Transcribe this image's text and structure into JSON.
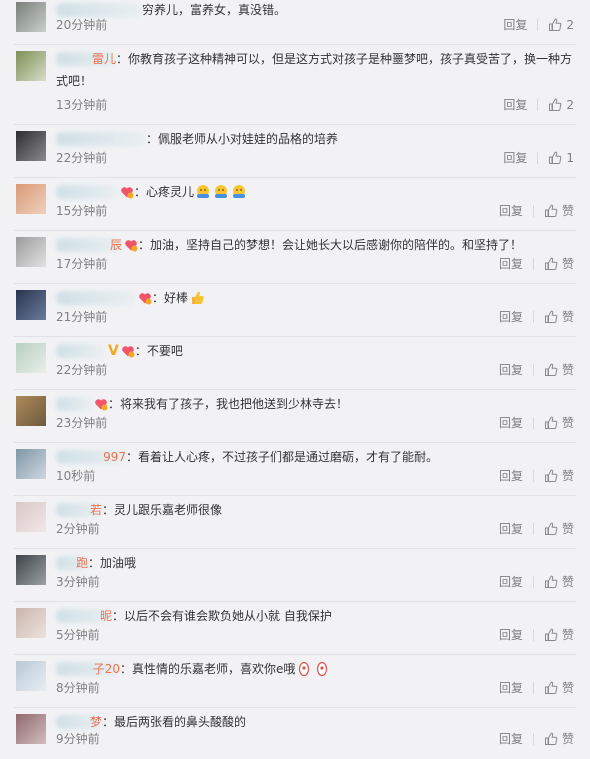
{
  "colors": {
    "username": "#eb7350",
    "text": "#333333",
    "meta": "#808080",
    "bg": "#f2f2f5"
  },
  "comments": [
    {
      "name_tail": "",
      "text": "穷养儿，富养女，真没错。",
      "time": "20分钟前",
      "reply": "回复",
      "like": "2",
      "badge": "none",
      "emoji": []
    },
    {
      "name_tail": "雷儿",
      "text": "：你教育孩子这种精神可以，但是这方式对孩子是种噩梦吧，孩子真受苦了，换一种方式吧！",
      "time": "13分钟前",
      "reply": "回复",
      "like": "2",
      "badge": "none",
      "emoji": []
    },
    {
      "name_tail": "",
      "text": "：佩服老师从小对娃娃的品格的培养",
      "time": "22分钟前",
      "reply": "回复",
      "like": "1",
      "badge": "none",
      "emoji": []
    },
    {
      "name_tail": "",
      "text": "：心疼灵儿",
      "time": "15分钟前",
      "reply": "回复",
      "like": "赞",
      "badge": "vip-heart",
      "emoji": [
        "hug-emoji",
        "hug-emoji",
        "hug-emoji"
      ]
    },
    {
      "name_tail": "辰",
      "text": "：加油，坚持自己的梦想！会让她长大以后感谢你的陪伴的。和坚持了！",
      "time": "17分钟前",
      "reply": "回复",
      "like": "赞",
      "badge": "vip-heart",
      "emoji": []
    },
    {
      "name_tail": "",
      "text": "：好棒",
      "time": "21分钟前",
      "reply": "回复",
      "like": "赞",
      "badge": "vip-heart",
      "emoji": [
        "thumbs-up-emoji"
      ]
    },
    {
      "name_tail": "",
      "text": "：不要吧",
      "time": "22分钟前",
      "reply": "回复",
      "like": "赞",
      "badge": "v-vip-heart",
      "emoji": []
    },
    {
      "name_tail": "",
      "text": "：将来我有了孩子，我也把他送到少林寺去！",
      "time": "23分钟前",
      "reply": "回复",
      "like": "赞",
      "badge": "vip-heart",
      "emoji": []
    },
    {
      "name_tail": "997",
      "text": "：看着让人心疼，不过孩子们都是通过磨砺，才有了能耐。",
      "time": "10秒前",
      "reply": "回复",
      "like": "赞",
      "badge": "none",
      "emoji": []
    },
    {
      "name_tail": "若",
      "text": "：灵儿跟乐嘉老师很像",
      "time": "2分钟前",
      "reply": "回复",
      "like": "赞",
      "badge": "none",
      "emoji": []
    },
    {
      "name_tail": "跑",
      "text": "：加油哦",
      "time": "3分钟前",
      "reply": "回复",
      "like": "赞",
      "badge": "none",
      "emoji": []
    },
    {
      "name_tail": "昵",
      "text": "：以后不会有谁会欺负她从小就 自我保护",
      "time": "5分钟前",
      "reply": "回复",
      "like": "赞",
      "badge": "none",
      "emoji": []
    },
    {
      "name_tail": "子20",
      "text": "：真性情的乐嘉老师，喜欢你e哦",
      "time": "8分钟前",
      "reply": "回复",
      "like": "赞",
      "badge": "none",
      "emoji": [
        "lucky-emoji",
        "lucky-emoji"
      ]
    },
    {
      "name_tail": "梦",
      "text": "：最后两张看的鼻头酸酸的",
      "time": "9分钟前",
      "reply": "回复",
      "like": "赞",
      "badge": "none",
      "emoji": []
    }
  ]
}
